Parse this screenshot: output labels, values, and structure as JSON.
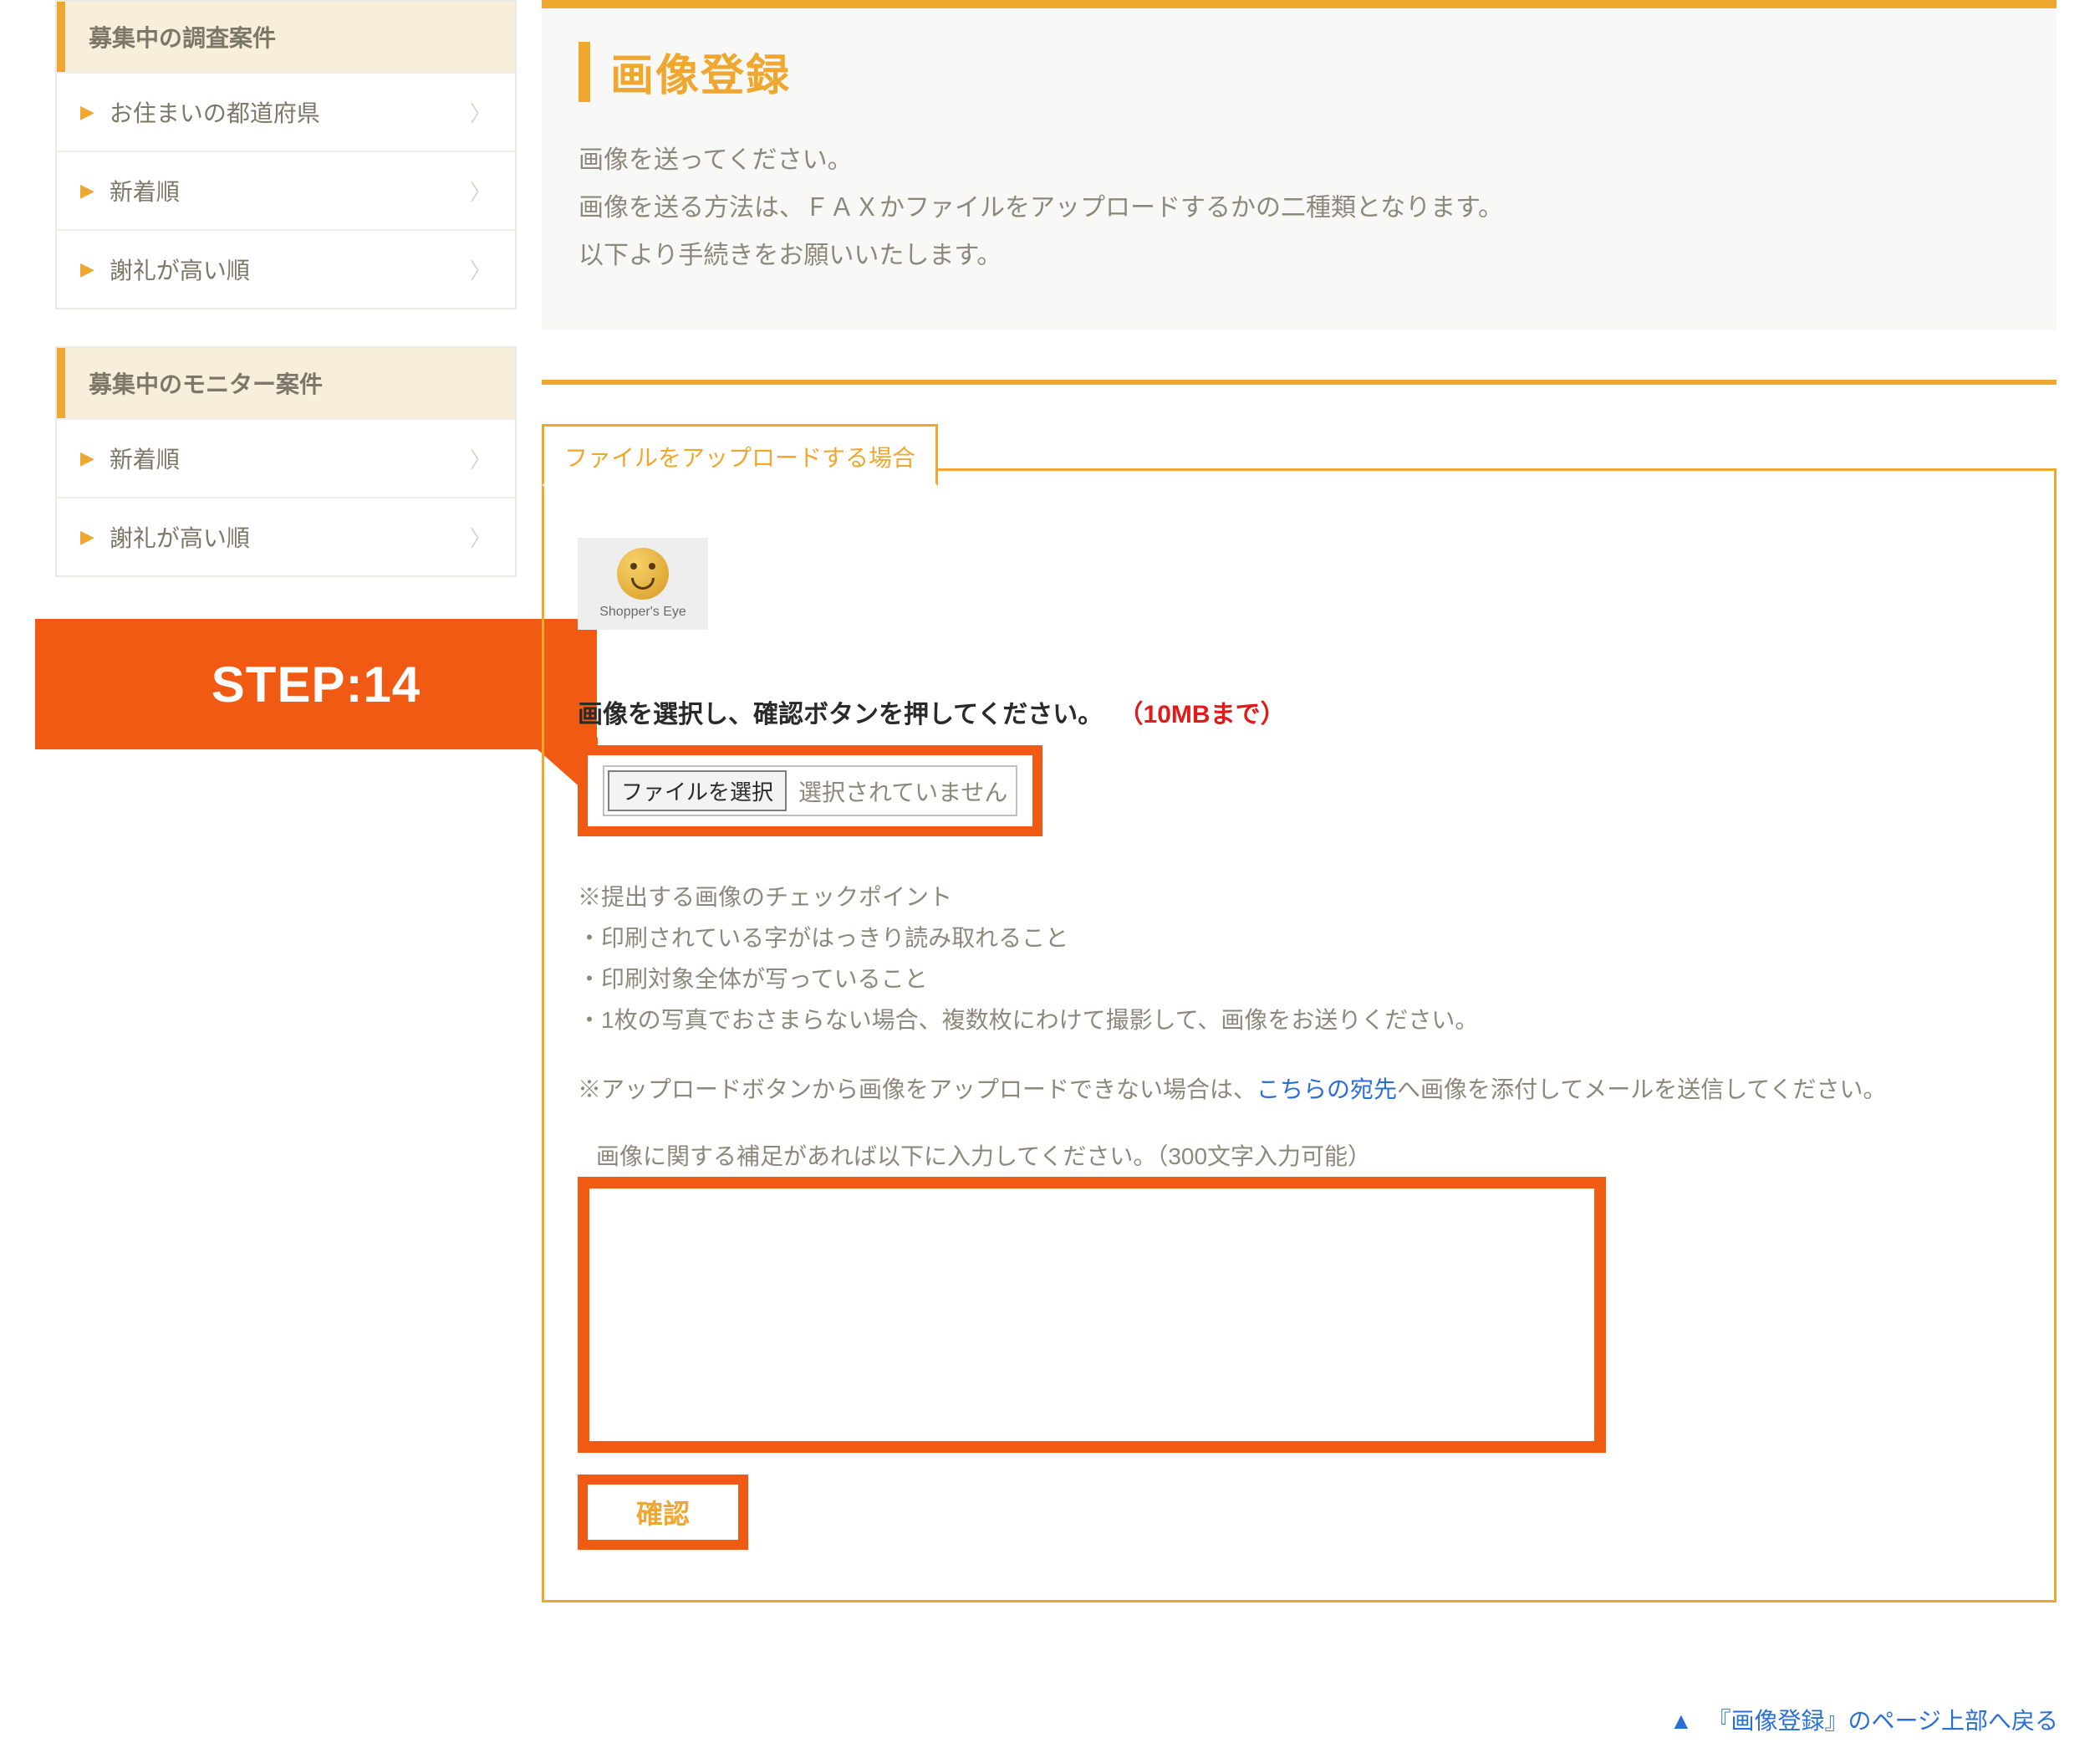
{
  "sidebar": {
    "group1": {
      "header": "募集中の調査案件",
      "items": [
        "お住まいの都道府県",
        "新着順",
        "謝礼が高い順"
      ]
    },
    "group2": {
      "header": "募集中のモニター案件",
      "items": [
        "新着順",
        "謝礼が高い順"
      ]
    }
  },
  "callout": {
    "text": "STEP:14"
  },
  "header": {
    "title": "画像登録",
    "line1": "画像を送ってください。",
    "line2": "画像を送る方法は、ＦＡＸかファイルをアップロードするかの二種類となります。",
    "line3": "以下より手続きをお願いいたします。"
  },
  "tab": {
    "label": "ファイルをアップロードする場合"
  },
  "thumb": {
    "caption": "Shopper's Eye"
  },
  "instruction": {
    "black": "画像を選択し、確認ボタンを押してください。",
    "red": "（10MBまで）"
  },
  "file": {
    "button": "ファイルを選択",
    "status": "選択されていません"
  },
  "notes": {
    "n1": "※提出する画像のチェックポイント",
    "n2": "・印刷されている字がはっきり読み取れること",
    "n3": "・印刷対象全体が写っていること",
    "n4": "・1枚の写真でおさまらない場合、複数枚にわけて撮影して、画像をお送りください。",
    "n5a": "※アップロードボタンから画像をアップロードできない場合は、",
    "n5link": "こちらの宛先",
    "n5b": "へ画像を添付してメールを送信してください。"
  },
  "supplement": {
    "label": "画像に関する補足があれば以下に入力してください。（300文字入力可能）"
  },
  "confirm": {
    "label": "確認"
  },
  "backtop": {
    "label": "『画像登録』のページ上部へ戻る"
  }
}
